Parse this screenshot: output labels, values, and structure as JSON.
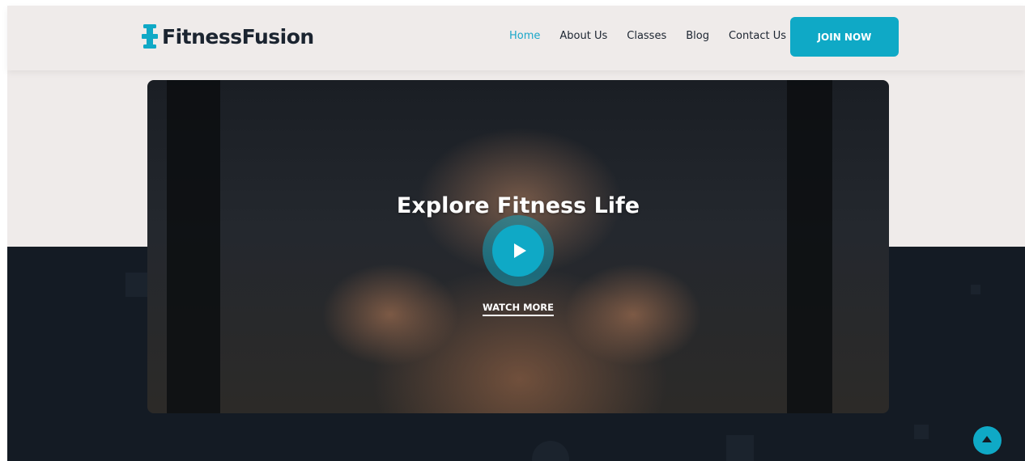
{
  "brand": {
    "name": "FitnessFusion",
    "accent_color": "#0fa9c6",
    "dark_color": "#141b24",
    "light_color": "#efebea",
    "logo_icon": "dumbbell-icon"
  },
  "nav": {
    "items": [
      {
        "label": "Home",
        "active": true
      },
      {
        "label": "About Us",
        "active": false
      },
      {
        "label": "Classes",
        "active": false
      },
      {
        "label": "Blog",
        "active": false
      },
      {
        "label": "Contact Us",
        "active": false
      }
    ],
    "cta_label": "JOIN NOW"
  },
  "hero": {
    "title": "Explore Fitness Life",
    "play_icon": "play-icon",
    "watch_label": "WATCH MORE"
  },
  "scroll_top": {
    "icon": "arrow-up-icon"
  }
}
